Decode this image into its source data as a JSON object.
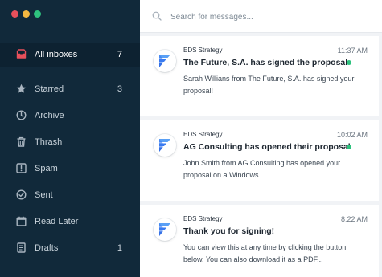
{
  "window": {
    "controls": [
      "close",
      "minimize",
      "maximize"
    ],
    "dot_colors": [
      "#e8505b",
      "#f5b841",
      "#2ec27e"
    ]
  },
  "sidebar": {
    "items": [
      {
        "id": "all-inboxes",
        "label": "All inboxes",
        "count": "7",
        "icon": "inbox-tray-icon",
        "active": true,
        "icon_color": "#e8505b"
      },
      {
        "id": "starred",
        "label": "Starred",
        "count": "3",
        "icon": "star-icon"
      },
      {
        "id": "archive",
        "label": "Archive",
        "count": "",
        "icon": "clock-icon"
      },
      {
        "id": "thrash",
        "label": "Thrash",
        "count": "",
        "icon": "trash-icon"
      },
      {
        "id": "spam",
        "label": "Spam",
        "count": "",
        "icon": "spam-alert-icon"
      },
      {
        "id": "sent",
        "label": "Sent",
        "count": "",
        "icon": "check-circle-icon"
      },
      {
        "id": "read-later",
        "label": "Read Later",
        "count": "",
        "icon": "calendar-icon"
      },
      {
        "id": "drafts",
        "label": "Drafts",
        "count": "1",
        "icon": "document-icon"
      }
    ],
    "colors": {
      "background": "#11293a",
      "active_background": "#0d2231"
    }
  },
  "search": {
    "placeholder": "Search for messages..."
  },
  "messages": [
    {
      "sender": "EDS Strategy",
      "time": "11:37 AM",
      "subject": "The Future, S.A. has signed the proposal",
      "preview": "Sarah Willians from The Future, S.A. has signed your proposal!",
      "unread": true
    },
    {
      "sender": "EDS Strategy",
      "time": "10:02 AM",
      "subject": "AG Consulting has opened their proposal",
      "preview": "John Smith from AG Consulting has opened your proposal on a Windows...",
      "unread": true
    },
    {
      "sender": "EDS Strategy",
      "time": "8:22 AM",
      "subject": "Thank you for signing!",
      "preview": "You can view this at any time by clicking the button below. You can also download it as a PDF...",
      "unread": false
    }
  ],
  "accent_colors": {
    "unread_dot": "#2ec27e",
    "logo_blue": "#3a7bf0"
  }
}
